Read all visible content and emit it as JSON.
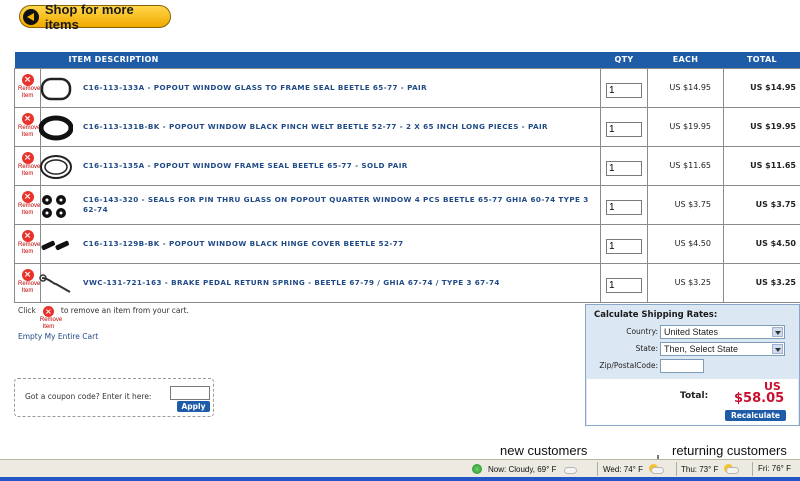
{
  "header": {
    "shop_label": "Shop for more items"
  },
  "table": {
    "headers": {
      "item": "ITEM DESCRIPTION",
      "qty": "QTY",
      "each": "EACH",
      "total": "TOTAL"
    },
    "remove_label_1": "Remove",
    "remove_label_2": "Item",
    "rows": [
      {
        "desc": "C16-113-133A - POPOUT WINDOW GLASS TO FRAME SEAL BEETLE 65-77 - PAIR",
        "qty": "1",
        "each": "US $14.95",
        "total": "US $14.95"
      },
      {
        "desc": "C16-113-131B-BK - POPOUT WINDOW BLACK PINCH WELT BEETLE 52-77 - 2 X 65 INCH LONG PIECES - PAIR",
        "qty": "1",
        "each": "US $19.95",
        "total": "US $19.95"
      },
      {
        "desc": "C16-113-135A - POPOUT WINDOW FRAME SEAL BEETLE 65-77 - SOLD PAIR",
        "qty": "1",
        "each": "US $11.65",
        "total": "US $11.65"
      },
      {
        "desc": "C16-143-320 - SEALS FOR PIN THRU GLASS ON POPOUT QUARTER WINDOW 4 PCS BEETLE 65-77 GHIA 60-74 TYPE 3 62-74",
        "qty": "1",
        "each": "US $3.75",
        "total": "US $3.75"
      },
      {
        "desc": "C16-113-129B-BK - POPOUT WINDOW BLACK HINGE COVER BEETLE 52-77",
        "qty": "1",
        "each": "US $4.50",
        "total": "US $4.50"
      },
      {
        "desc": "VWC-131-721-163 - BRAKE PEDAL RETURN SPRING - BEETLE 67-79 / GHIA 67-74 / TYPE 3 67-74",
        "qty": "1",
        "each": "US $3.25",
        "total": "US $3.25"
      }
    ]
  },
  "cart_help": {
    "click": "Click",
    "rest": "to remove an item from your cart.",
    "empty": "Empty My Entire Cart"
  },
  "coupon": {
    "question": "Got a coupon code? Enter it here:",
    "apply": "Apply"
  },
  "shipping": {
    "title": "Calculate Shipping Rates:",
    "country_label": "Country:",
    "country_value": "United States",
    "state_label": "State:",
    "state_value": "Then, Select State",
    "zip_label": "Zip/PostalCode:",
    "total_label": "Total:",
    "currency": "US",
    "total_value": "$58.05",
    "recalc": "Recalculate"
  },
  "captions": {
    "new": "new customers",
    "returning": "returning customers"
  },
  "taskbar": {
    "now": "Now: Cloudy, 69° F",
    "wed": "Wed: 74° F",
    "thu": "Thu: 73° F",
    "fri": "Fri: 76° F",
    "weather_icon": "partly-cloudy-icon"
  },
  "colors": {
    "header_blue": "#1f5ca8",
    "link_blue": "#1f4a86",
    "total_red": "#c8102e",
    "button_yellow": "#f1a900"
  }
}
